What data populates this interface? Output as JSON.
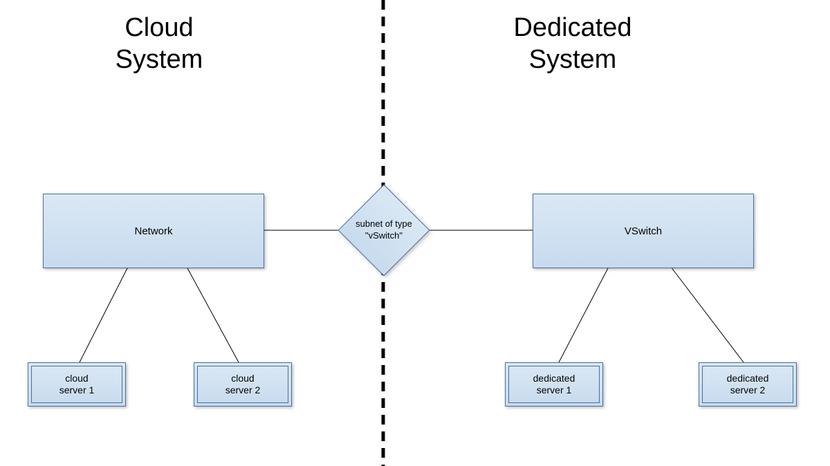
{
  "titles": {
    "left": "Cloud\nSystem",
    "right": "Dedicated\nSystem"
  },
  "nodes": {
    "network": "Network",
    "vswitch": "VSwitch",
    "subnet": "subnet of type\n\"vSwitch\"",
    "cloud_server_1": "cloud\nserver 1",
    "cloud_server_2": "cloud\nserver 2",
    "dedicated_server_1": "dedicated\nserver 1",
    "dedicated_server_2": "dedicated\nserver 2"
  },
  "connections": [
    {
      "from": "network",
      "to": "subnet"
    },
    {
      "from": "subnet",
      "to": "vswitch"
    },
    {
      "from": "network",
      "to": "cloud_server_1"
    },
    {
      "from": "network",
      "to": "cloud_server_2"
    },
    {
      "from": "vswitch",
      "to": "dedicated_server_1"
    },
    {
      "from": "vswitch",
      "to": "dedicated_server_2"
    }
  ]
}
